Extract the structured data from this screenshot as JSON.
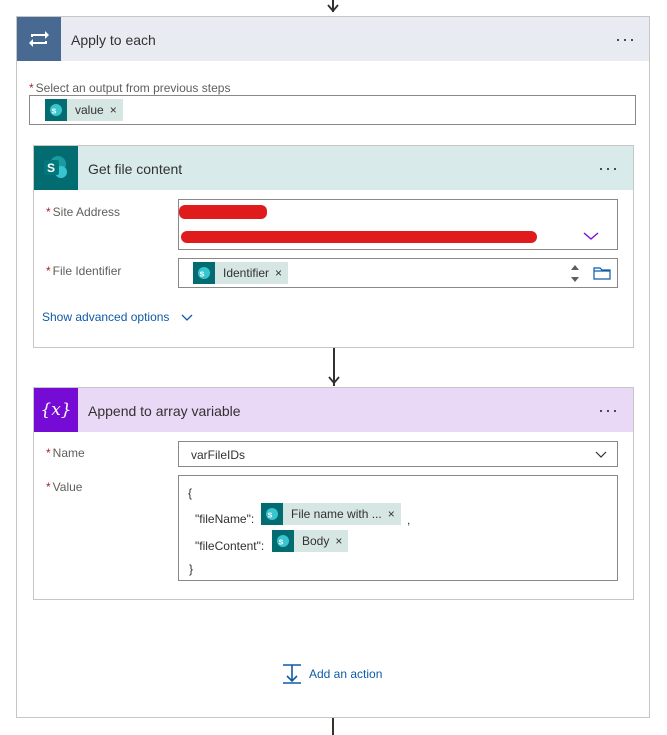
{
  "apply_to_each": {
    "title": "Apply to each",
    "more_label": "···",
    "select_label": "Select an output from previous steps",
    "required_mark": "*",
    "token": {
      "label": "value",
      "remove": "×"
    }
  },
  "get_file_content": {
    "title": "Get file content",
    "more_label": "···",
    "site_address_label": "Site Address",
    "file_identifier_label": "File Identifier",
    "file_identifier_token": {
      "label": "Identifier",
      "remove": "×"
    },
    "show_advanced": "Show advanced options",
    "required_mark": "*"
  },
  "append_to_array": {
    "title": "Append to array variable",
    "icon_text": "{x}",
    "more_label": "···",
    "name_label": "Name",
    "name_value": "varFileIDs",
    "value_label": "Value",
    "required_mark": "*",
    "value_lines": {
      "open_brace": "{",
      "file_name_key": "\"fileName\":",
      "file_name_token": {
        "label": "File name with ...",
        "remove": "×"
      },
      "comma": ",",
      "file_content_key": "\"fileContent\":",
      "file_content_token": {
        "label": "Body",
        "remove": "×"
      },
      "close_brace": "}"
    }
  },
  "add_action": {
    "label": "Add an action"
  },
  "colors": {
    "loop_accent": "#486991",
    "sharepoint_accent": "#036c70",
    "variable_accent": "#770bd6",
    "link": "#0f5ba5",
    "required": "#a4262c"
  },
  "icons": {
    "loop": "loop-icon",
    "sharepoint": "sharepoint-icon",
    "variable": "variable-icon",
    "chevron": "chevron-down-icon",
    "folder": "folder-icon",
    "add_action": "add-action-icon"
  }
}
